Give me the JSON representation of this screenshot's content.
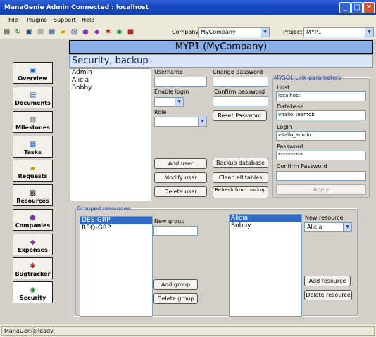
{
  "window": {
    "title": "ManaGenie Admin Connected : localhost",
    "min": "_",
    "max": "□",
    "close": "✕"
  },
  "menu": {
    "items": [
      "File",
      "Plugins",
      "Support",
      "Help"
    ]
  },
  "toolbar": {
    "icons": [
      "print-icon",
      "refresh-icon",
      "document-icon",
      "chart-icon",
      "calendar-icon",
      "folder-icon",
      "tasks-icon",
      "people-icon",
      "expenses-icon",
      "bug-icon",
      "security-icon",
      "settings-icon"
    ],
    "company_label": "Company",
    "company_value": "MyCompany",
    "project_label": "Project",
    "project_value": "MYP1"
  },
  "nav": {
    "items": [
      {
        "label": "Overview",
        "icon": "overview-icon"
      },
      {
        "label": "Documents",
        "icon": "documents-icon"
      },
      {
        "label": "Milestones",
        "icon": "milestones-icon"
      },
      {
        "label": "Tasks",
        "icon": "tasks-icon"
      },
      {
        "label": "Requests",
        "icon": "requests-icon"
      },
      {
        "label": "Resources",
        "icon": "resources-icon"
      },
      {
        "label": "Companies",
        "icon": "companies-icon"
      },
      {
        "label": "Expenses",
        "icon": "expenses-icon"
      },
      {
        "label": "Bugtracker",
        "icon": "bugtracker-icon"
      },
      {
        "label": "Security",
        "icon": "security-icon"
      }
    ]
  },
  "header": {
    "title": "MYP1 (MyCompany)",
    "subtitle": "Security, backup"
  },
  "users": {
    "list": [
      "Admin",
      "Alicia",
      "Bobby"
    ]
  },
  "form": {
    "username_label": "Username",
    "username_value": "",
    "enable_login_label": "Enable login",
    "enable_login_value": "",
    "role_label": "Role",
    "role_value": "",
    "change_password_label": "Change password",
    "change_password_value": "",
    "confirm_password_label": "Confirm password",
    "confirm_password_value": "",
    "reset_password": "Reset Password",
    "add_user": "Add user",
    "modify_user": "Modify user",
    "delete_user": "Delete user",
    "backup_database": "Backup database",
    "clean_all_tables": "Clean all tables",
    "refresh_from_backup": "Refresh from backup"
  },
  "mysql": {
    "legend": "MYSQL Link parameters",
    "host_label": "Host",
    "host_value": "localhost",
    "database_label": "Database",
    "database_value": "vitallo_teamdb",
    "login_label": "Login",
    "login_value": "vitallo_admin",
    "password_label": "Password",
    "password_value": "**********",
    "confirm_label": "Confirm Password",
    "confirm_value": "",
    "apply": "Apply"
  },
  "groups": {
    "legend": "Grouped resources",
    "list": [
      "DES-GRP",
      "REQ-GRP"
    ],
    "selected": "DES-GRP",
    "new_group_label": "New group",
    "new_group_value": "",
    "add_group": "Add group",
    "delete_group": "Delete group",
    "resources": [
      "Alicia",
      "Bobby"
    ],
    "selected_resource": "Alicia",
    "new_resource_label": "New resource",
    "new_resource_value": "Alicia",
    "add_resource": "Add resource",
    "delete_resource": "Delete resource"
  },
  "status": {
    "app": "ManaGenie",
    "state": "Ready"
  }
}
